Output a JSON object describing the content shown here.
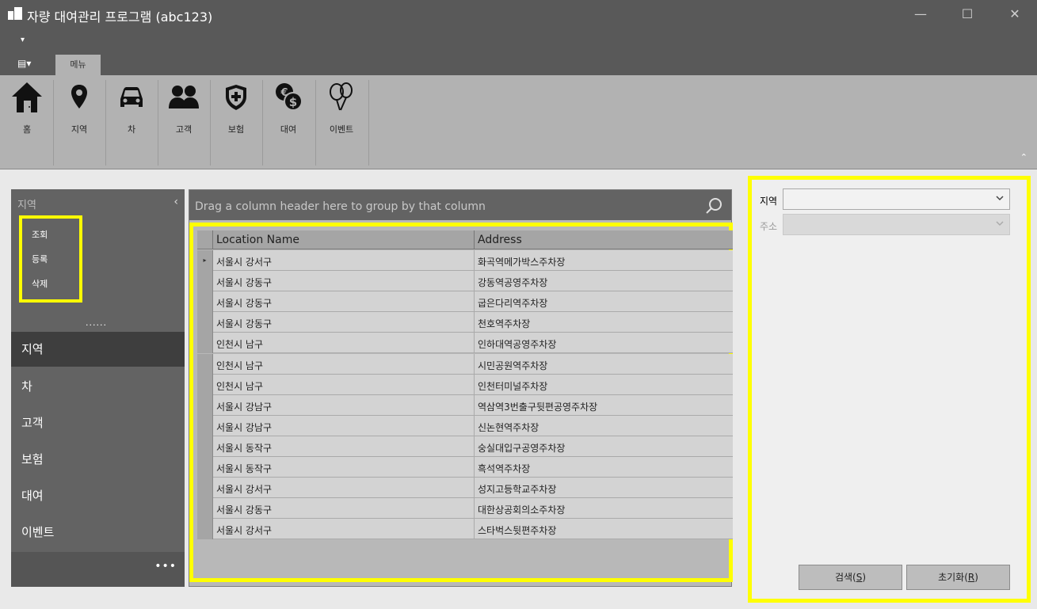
{
  "window": {
    "title": "자량 대여관리 프로그램 (abc123)",
    "minimize": "—",
    "maximize": "☐",
    "close": "✕"
  },
  "ribbon": {
    "qat_arrow": "▾",
    "file_tab": "▤▾",
    "menu_tab": "메뉴",
    "collapse": "⌃",
    "buttons": [
      {
        "label": "홈",
        "icon": "home-icon"
      },
      {
        "label": "지역",
        "icon": "map-pin-icon"
      },
      {
        "label": "차",
        "icon": "car-icon"
      },
      {
        "label": "고객",
        "icon": "users-icon"
      },
      {
        "label": "보험",
        "icon": "shield-icon"
      },
      {
        "label": "대여",
        "icon": "coins-icon"
      },
      {
        "label": "이벤트",
        "icon": "balloons-icon"
      }
    ]
  },
  "nav": {
    "header": "지역",
    "collapse": "‹",
    "subitems": [
      "조회",
      "등록",
      "삭제"
    ],
    "splitter_dots": "......",
    "groups": [
      "지역",
      "차",
      "고객",
      "보험",
      "대여",
      "이벤트"
    ],
    "selected_group": "지역",
    "footer_dots": "•••"
  },
  "grid": {
    "group_panel_text": "Drag a column header here to group by that column",
    "columns": [
      "Location Name",
      "Address"
    ],
    "current_row_marker": "▸",
    "rows": [
      [
        "서울시 강서구",
        "화곡역메가박스주차장"
      ],
      [
        "서울시 강동구",
        "강동역공영주차장"
      ],
      [
        "서울시 강동구",
        "굽은다리역주차장"
      ],
      [
        "서울시 강동구",
        "천호역주차장"
      ],
      [
        "인천시 남구",
        "인하대역공영주차장"
      ],
      [
        "인천시 남구",
        "시민공원역주차장"
      ],
      [
        "인천시 남구",
        "인천터미널주차장"
      ],
      [
        "서울시 강남구",
        "역삼역3번출구뒷편공영주차장"
      ],
      [
        "서울시 강남구",
        "신논현역주차장"
      ],
      [
        "서울시 동작구",
        "숭실대입구공영주차장"
      ],
      [
        "서울시 동작구",
        "흑석역주차장"
      ],
      [
        "서울시 강서구",
        "성지고등학교주차장"
      ],
      [
        "서울시 강동구",
        "대한상공회의소주차장"
      ],
      [
        "서울시 강서구",
        "스타벅스뒷편주차장"
      ]
    ]
  },
  "search": {
    "region_label": "지역",
    "region_value": "",
    "address_label": "주소",
    "address_value": "",
    "search_button": "검색(S)",
    "search_text": "검색",
    "search_key": "S",
    "reset_text": "초기화",
    "reset_key": "R"
  },
  "colors": {
    "titlebar": "#595959",
    "ribbon": "#b2b2b2",
    "nav": "#636363",
    "highlight": "#ffff00"
  }
}
